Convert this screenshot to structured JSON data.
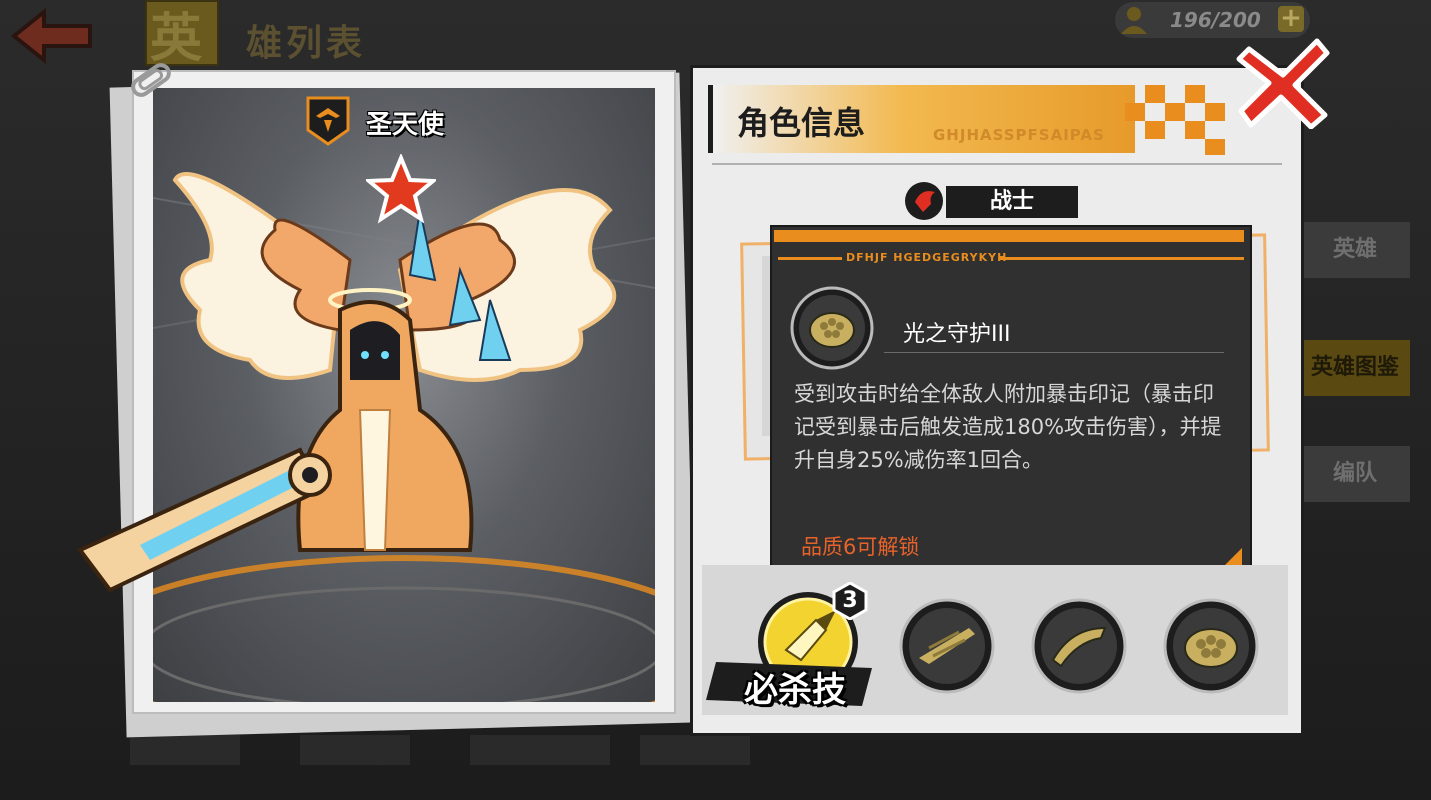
{
  "top_bar": {
    "title_first": "英",
    "title_rest": "雄列表",
    "resource_count": "196/200",
    "resource_plus": "+"
  },
  "side_tabs": [
    "英雄",
    "英雄图鉴",
    "编队"
  ],
  "hero": {
    "name": "圣天使",
    "class_icon": "eagle-emblem-icon"
  },
  "panel": {
    "title": "角色信息",
    "code_text": "GHJHASSPFSAIPAS",
    "type_label": "战士"
  },
  "tooltip": {
    "code_text": "DFHJF HGEDGEGRYKYH",
    "skill_name": "光之守护III",
    "description": "受到攻击时给全体敌人附加暴击印记（暴击印记受到暴击后触发造成180%攻击伤害），并提升自身25%减伤率1回合。",
    "unlock": "品质6可解锁"
  },
  "skills": {
    "ultimate_label": "必杀技",
    "ultimate_level": "3",
    "icons": [
      "ultimate-strike-icon",
      "wing-slash-icon",
      "wave-blade-icon",
      "shell-shield-icon"
    ]
  },
  "colors": {
    "accent": "#e88d1e",
    "close": "#e02f22",
    "unlock": "#e8622a",
    "panel": "#ececec"
  }
}
